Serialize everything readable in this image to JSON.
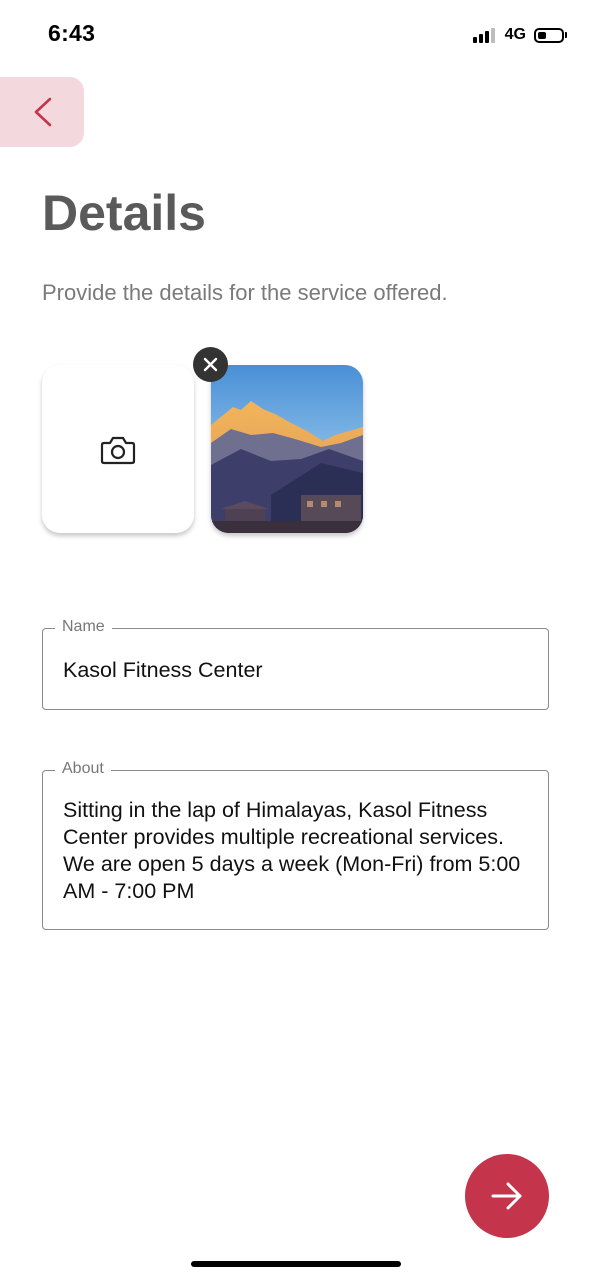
{
  "status_bar": {
    "time": "6:43",
    "network": "4G",
    "battery_level": 0.35,
    "signal_bars_active": 3,
    "signal_bars_total": 4
  },
  "header": {
    "back_icon": "chevron-left-icon",
    "title": "Details",
    "subtitle": "Provide the details for the service offered."
  },
  "photos": {
    "add_icon": "camera-icon",
    "remove_icon": "close-icon",
    "items_count": 1
  },
  "form": {
    "name": {
      "label": "Name",
      "value": "Kasol Fitness Center"
    },
    "about": {
      "label": "About",
      "value": "Sitting in the lap of Himalayas, Kasol Fitness Center provides multiple recreational services. We are open 5 days a week (Mon-Fri) from 5:00 AM - 7:00 PM"
    }
  },
  "actions": {
    "next_icon": "arrow-right-icon"
  },
  "colors": {
    "accent": "#c4344a",
    "back_button_bg": "#f3d9dd",
    "title_text": "#5a5a5a"
  }
}
